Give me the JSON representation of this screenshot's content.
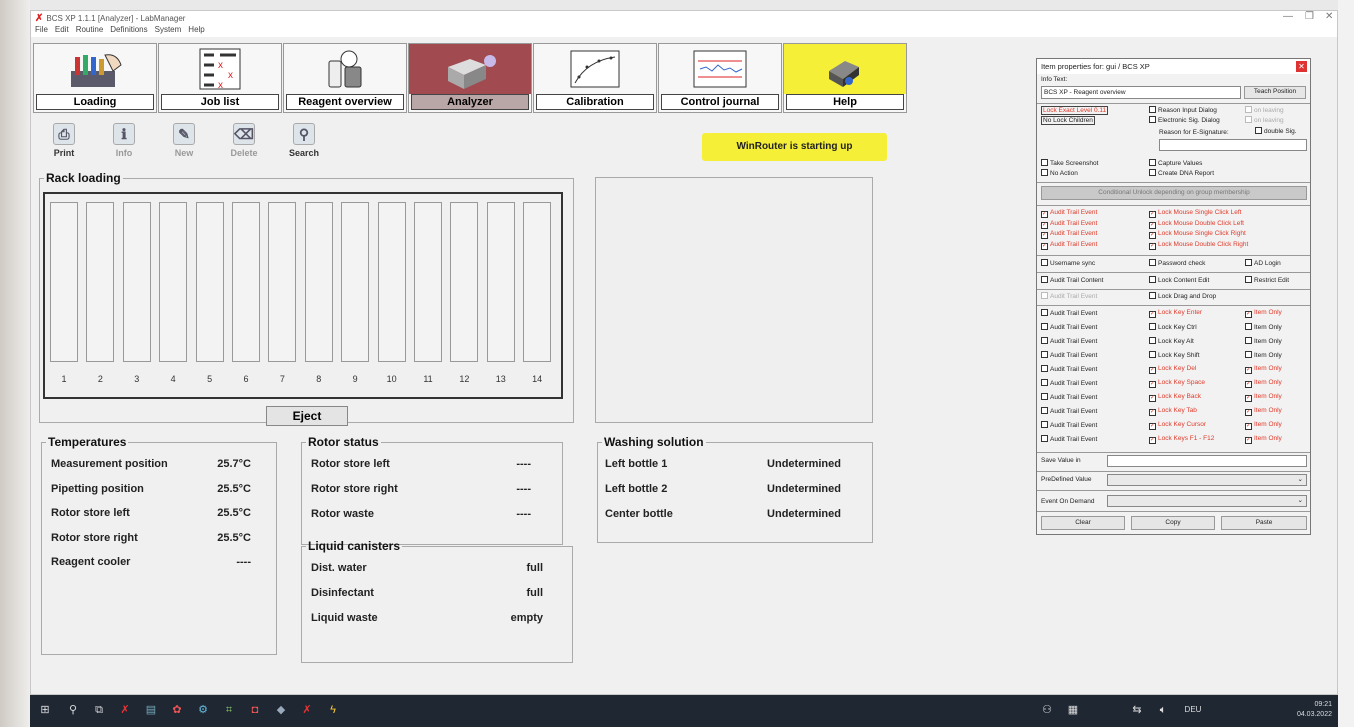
{
  "window": {
    "title": "BCS XP 1.1.1 [Analyzer] - LabManager"
  },
  "menu": [
    "File",
    "Edit",
    "Routine",
    "Definitions",
    "System",
    "Help"
  ],
  "nav": [
    {
      "label": "Loading",
      "icon": "tube-rack-icon"
    },
    {
      "label": "Job list",
      "icon": "job-list-icon"
    },
    {
      "label": "Reagent overview",
      "icon": "reagent-bottles-icon"
    },
    {
      "label": "Analyzer",
      "icon": "analyzer-icon"
    },
    {
      "label": "Calibration",
      "icon": "calibration-curve-icon"
    },
    {
      "label": "Control journal",
      "icon": "control-chart-icon"
    },
    {
      "label": "Help",
      "icon": "help-icon"
    }
  ],
  "toolbar": [
    {
      "label": "Print",
      "icon": "printer-icon"
    },
    {
      "label": "Info",
      "icon": "info-icon"
    },
    {
      "label": "New",
      "icon": "new-icon"
    },
    {
      "label": "Delete",
      "icon": "delete-icon"
    },
    {
      "label": "Search",
      "icon": "search-icon"
    }
  ],
  "status_banner": "WinRouter is starting up",
  "rack": {
    "title": "Rack loading",
    "slots": [
      "1",
      "2",
      "3",
      "4",
      "5",
      "6",
      "7",
      "8",
      "9",
      "10",
      "11",
      "12",
      "13",
      "14"
    ],
    "eject_label": "Eject"
  },
  "temperatures": {
    "title": "Temperatures",
    "rows": [
      {
        "name": "Measurement position",
        "value": "25.7°C"
      },
      {
        "name": "Pipetting position",
        "value": "25.5°C"
      },
      {
        "name": "Rotor store left",
        "value": "25.5°C"
      },
      {
        "name": "Rotor store right",
        "value": "25.5°C"
      },
      {
        "name": "Reagent cooler",
        "value": "----"
      }
    ]
  },
  "rotor": {
    "title": "Rotor status",
    "rows": [
      {
        "name": "Rotor store left",
        "value": "----"
      },
      {
        "name": "Rotor store right",
        "value": "----"
      },
      {
        "name": "Rotor waste",
        "value": "----"
      }
    ]
  },
  "liquid": {
    "title": "Liquid canisters",
    "rows": [
      {
        "name": "Dist. water",
        "value": "full"
      },
      {
        "name": "Disinfectant",
        "value": "full"
      },
      {
        "name": "Liquid waste",
        "value": "empty"
      }
    ]
  },
  "washing": {
    "title": "Washing solution",
    "rows": [
      {
        "name": "Left bottle 1",
        "value": "Undetermined"
      },
      {
        "name": "Left bottle 2",
        "value": "Undetermined"
      },
      {
        "name": "Center bottle",
        "value": "Undetermined"
      }
    ]
  },
  "dialog": {
    "title": "Item properties for: gui / BCS XP",
    "info_label": "Info Text:",
    "info_value": "BCS XP - Reagent overview",
    "teach_button": "Teach Position",
    "lock_exact": "Lock Exact Level 0.11",
    "no_lock_children": "No Lock Children",
    "reason_input": "Reason Input Dialog",
    "electronic_sig": "Electronic Sig. Dialog",
    "on_leaving": "on leaving",
    "reason_esig": "Reason for E-Signature:",
    "double_sig": "double Sig.",
    "take_screenshot": "Take Screenshot",
    "no_action": "No Action",
    "capture_values": "Capture Values",
    "create_dna": "Create DNA Report",
    "conditional_unlock": "Conditional Unlock depending on group membership",
    "audit_trail_event": "Audit Trail Event",
    "mouse_locks": [
      "Lock Mouse Single Click Left",
      "Lock Mouse Double Click Left",
      "Lock Mouse Single Click Right",
      "Lock Mouse Double Click Right"
    ],
    "username_sync": "Username sync",
    "password_check": "Password check",
    "ad_login": "AD Login",
    "audit_trail_content": "Audit Trail Content",
    "lock_content_edit": "Lock Content Edit",
    "restrict_edit": "Restrict Edit",
    "lock_drag_drop": "Lock Drag and Drop",
    "item_only": "Item Only",
    "key_locks": [
      {
        "label": "Lock Key Enter",
        "checked": true
      },
      {
        "label": "Lock Key Ctrl",
        "checked": false
      },
      {
        "label": "Lock Key Alt",
        "checked": false
      },
      {
        "label": "Lock Key Shift",
        "checked": false
      },
      {
        "label": "Lock Key Del",
        "checked": true
      },
      {
        "label": "Lock Key Space",
        "checked": true
      },
      {
        "label": "Lock Key Back",
        "checked": true
      },
      {
        "label": "Lock Key Tab",
        "checked": true
      },
      {
        "label": "Lock Key Cursor",
        "checked": true
      },
      {
        "label": "Lock Keys F1 - F12",
        "checked": true
      }
    ],
    "save_value_in": "Save Value in",
    "predefined_value": "PreDefined Value",
    "event_on_demand": "Event On Demand",
    "clear": "Clear",
    "copy": "Copy",
    "paste": "Paste"
  },
  "taskbar": {
    "lang": "DEU",
    "time": "09:21",
    "date": "04.03.2022"
  },
  "colors": {
    "active_nav": "#a14a4f",
    "banner": "#f5ef38",
    "dialog_red": "#e03a2a"
  }
}
